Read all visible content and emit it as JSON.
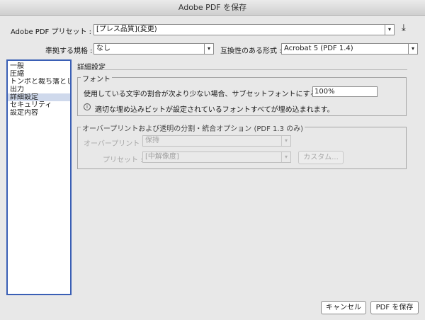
{
  "window": {
    "title": "Adobe PDF を保存"
  },
  "header": {
    "preset_label": "Adobe PDF プリセット :",
    "preset_value": "[プレス品質](変更)",
    "standard_label": "準拠する規格 :",
    "standard_value": "なし",
    "compat_label": "互換性のある形式 :",
    "compat_value": "Acrobat 5 (PDF 1.4)"
  },
  "sidebar": {
    "items": [
      {
        "label": "一般"
      },
      {
        "label": "圧縮"
      },
      {
        "label": "トンボと裁ち落とし"
      },
      {
        "label": "出力"
      },
      {
        "label": "詳細設定"
      },
      {
        "label": "セキュリティ"
      },
      {
        "label": "設定内容"
      }
    ],
    "selected": "詳細設定"
  },
  "main": {
    "section_title": "詳細設定",
    "font_group": {
      "legend": "フォント",
      "subset_label": "使用している文字の割合が次より少ない場合、サブセットフォントにする :",
      "subset_value": "100%",
      "info_icon_glyph": "i",
      "info_text": "適切な埋め込みビットが設定されているフォントすべてが埋め込まれます。"
    },
    "overprint_group": {
      "legend": "オーバープリントおよび透明の分割・統合オプション (PDF 1.3 のみ)",
      "overprint_label": "オーバープリント :",
      "overprint_value": "保持",
      "preset_label": "プリセット :",
      "preset_value": "[中解像度]",
      "custom_button": "カスタム..."
    }
  },
  "footer": {
    "cancel_button": "キャンセル",
    "save_button": "PDF を保存"
  },
  "icons": {
    "dropdown_arrow": "▾",
    "save_preset": "⤓"
  },
  "colors": {
    "sidebar_border": "#3a5fb5",
    "sidebar_selected": "#cfd9ec"
  }
}
